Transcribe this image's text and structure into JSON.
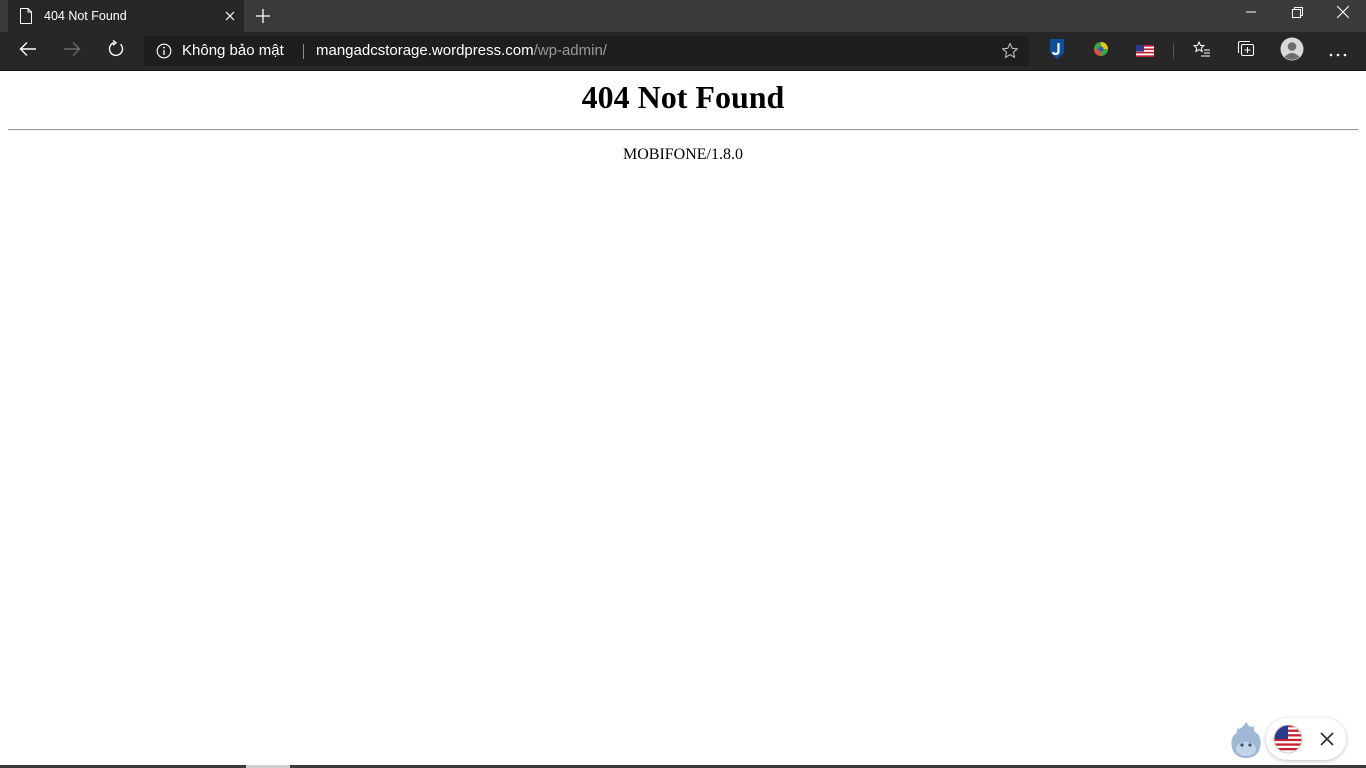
{
  "browser": {
    "tab": {
      "title": "404 Not Found"
    },
    "addressbar": {
      "security_label": "Không bảo mật",
      "url_host": "mangadcstorage.wordpress.com",
      "url_path": "/wp-admin/"
    },
    "icons": {
      "back": "back-arrow-icon",
      "forward": "forward-arrow-icon",
      "refresh": "refresh-icon",
      "favorite": "star-icon",
      "favorites_list": "favorites-list-icon",
      "collections": "collections-icon",
      "profile": "profile-icon",
      "more": "more-icon"
    },
    "colors": {
      "titlebar": "#3b3b3b",
      "toolbar": "#272727",
      "url_path": "#9a9a9a"
    }
  },
  "page": {
    "heading": "404 Not Found",
    "server": "MOBIFONE/1.8.0"
  }
}
